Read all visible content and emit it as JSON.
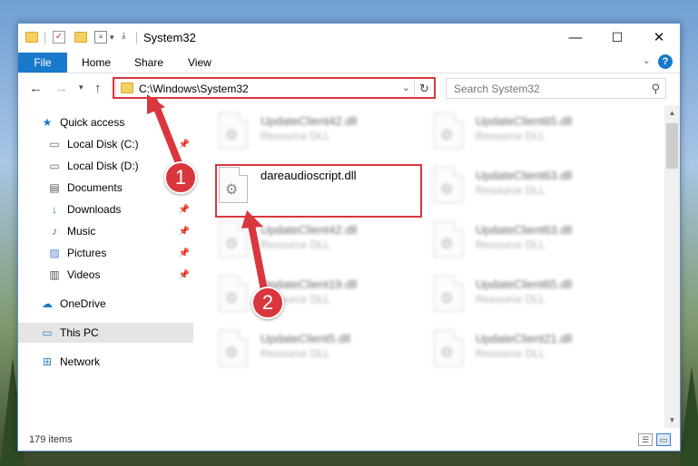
{
  "window": {
    "title": "System32",
    "controls": {
      "minimize": "—",
      "maximize": "☐",
      "close": "✕"
    }
  },
  "ribbon": {
    "tabs": [
      "File",
      "Home",
      "Share",
      "View"
    ],
    "help": "?"
  },
  "nav": {
    "address": "C:\\Windows\\System32",
    "search_placeholder": "Search System32"
  },
  "sidebar": {
    "items": [
      {
        "label": "Quick access",
        "icon": "star-icon",
        "pinned": false,
        "selected": false
      },
      {
        "label": "Local Disk (C:)",
        "icon": "drive-icon",
        "pinned": true,
        "selected": false
      },
      {
        "label": "Local Disk (D:)",
        "icon": "drive-icon",
        "pinned": false,
        "selected": false
      },
      {
        "label": "Documents",
        "icon": "documents-icon",
        "pinned": true,
        "selected": false
      },
      {
        "label": "Downloads",
        "icon": "downloads-icon",
        "pinned": true,
        "selected": false
      },
      {
        "label": "Music",
        "icon": "music-icon",
        "pinned": true,
        "selected": false
      },
      {
        "label": "Pictures",
        "icon": "pictures-icon",
        "pinned": true,
        "selected": false
      },
      {
        "label": "Videos",
        "icon": "videos-icon",
        "pinned": true,
        "selected": false
      },
      {
        "label": "OneDrive",
        "icon": "cloud-icon",
        "pinned": false,
        "selected": false
      },
      {
        "label": "This PC",
        "icon": "computer-icon",
        "pinned": false,
        "selected": true
      },
      {
        "label": "Network",
        "icon": "network-icon",
        "pinned": false,
        "selected": false
      }
    ]
  },
  "files": {
    "highlighted": {
      "name": "dareaudioscript.dll",
      "type": ""
    },
    "left_column": [
      {
        "name": "UpdateClient42.dll",
        "type": "Resource DLL"
      },
      {
        "name": "UpdateClient42.dll",
        "type": "Resource DLL"
      },
      {
        "name": "UpdateClient19.dll",
        "type": "Resource DLL"
      },
      {
        "name": "UpdateClient5.dll",
        "type": "Resource DLL"
      }
    ],
    "right_column": [
      {
        "name": "UpdateClient65.dll",
        "type": "Resource DLL"
      },
      {
        "name": "UpdateClient63.dll",
        "type": "Resource DLL"
      },
      {
        "name": "UpdateClient63.dll",
        "type": "Resource DLL"
      },
      {
        "name": "UpdateClient65.dll",
        "type": "Resource DLL"
      },
      {
        "name": "UpdateClient21.dll",
        "type": "Resource DLL"
      }
    ]
  },
  "status": {
    "item_count": "179 items"
  },
  "annotations": {
    "step1": "1",
    "step2": "2",
    "color": "#d9363e"
  }
}
